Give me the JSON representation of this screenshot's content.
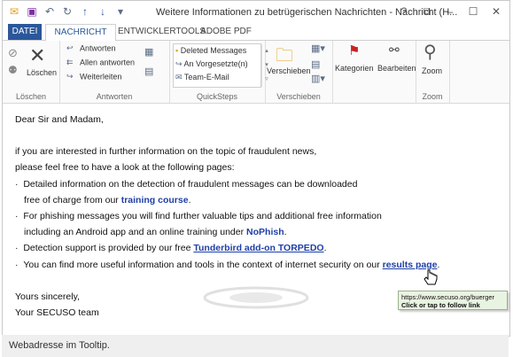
{
  "titlebar": {
    "title": "Weitere Informationen zu betrügerischen Nachrichten - Nachricht (H...",
    "controls": [
      "?",
      "⧉",
      "–",
      "☐",
      "✕"
    ]
  },
  "tabs": [
    {
      "label": "DATEI"
    },
    {
      "label": "NACHRICHT"
    },
    {
      "label": "ENTWICKLERTOOLS"
    },
    {
      "label": "ADOBE PDF"
    }
  ],
  "ribbon": {
    "loeschen": {
      "button": "Löschen",
      "group": "Löschen"
    },
    "antworten": {
      "reply": "Antworten",
      "reply_all": "Allen antworten",
      "forward": "Weiterleiten",
      "group": "Antworten"
    },
    "quicksteps": {
      "items": [
        "Deleted Messages",
        "An Vorgesetzte(n)",
        "Team-E-Mail"
      ],
      "group": "QuickSteps"
    },
    "verschieben": {
      "button": "Verschieben",
      "group": "Verschieben"
    },
    "kategorien": {
      "button": "Kategorien"
    },
    "bearbeiten": {
      "button": "Bearbeiten"
    },
    "zoom": {
      "button": "Zoom",
      "group": "Zoom"
    }
  },
  "message": {
    "greeting": "Dear Sir and Madam,",
    "intro1": "if you are interested in further information on the topic of fraudulent news,",
    "intro2": "please feel free to have a look at the following pages:",
    "b1a": "Detailed information on the detection of fraudulent messages can be downloaded",
    "b1b_pre": "free of charge from our ",
    "b1b_link": "training course",
    "b1b_post": ".",
    "b2a": "For phishing messages you will find further valuable tips and additional free information",
    "b2b_pre": "including an Android app and an online training under ",
    "b2b_link": "NoPhish",
    "b2b_post": ".",
    "b3_pre": "Detection support is provided by our free ",
    "b3_link": "Tunderbird add-on TORPEDO",
    "b3_post": ".",
    "b4_pre": "You can find more useful information and tools in the context of internet security on our ",
    "b4_link": "results page",
    "b4_post": ".",
    "closing1": "Yours sincerely,",
    "closing2": "Your SECUSO team",
    "bullet": "·"
  },
  "tooltip": {
    "url": "https://www.secuso.org/buerger",
    "hint": "Click or tap to follow link"
  },
  "caption": "Webadresse im Tooltip.",
  "colors": {
    "accent": "#2b579a",
    "link": "#1f3fa8",
    "tooltip_bg": "#e9f3e1"
  }
}
